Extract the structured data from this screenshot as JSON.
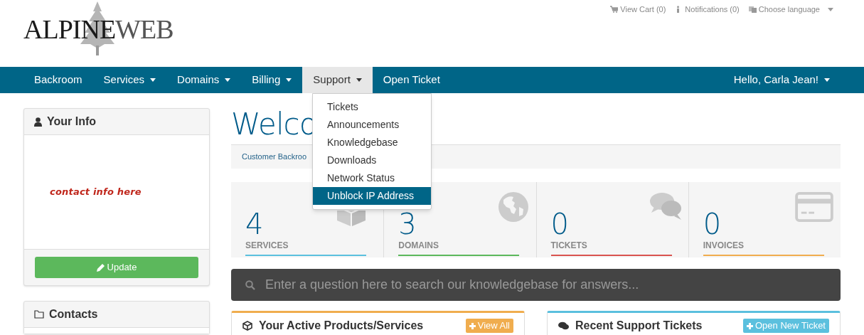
{
  "logo": {
    "part_1": "ALPINE",
    "part_2": "WEB"
  },
  "top_links": [
    {
      "kind": "cart",
      "label": "View Cart (0)",
      "caret": false
    },
    {
      "kind": "info",
      "label": "Notifications (0)",
      "caret": false
    },
    {
      "kind": "language",
      "label": "Choose language",
      "caret": true
    }
  ],
  "nav": {
    "items": [
      {
        "label": "Backroom",
        "caret": false,
        "selected": false
      },
      {
        "label": "Services",
        "caret": true,
        "selected": false
      },
      {
        "label": "Domains",
        "caret": true,
        "selected": false
      },
      {
        "label": "Billing",
        "caret": true,
        "selected": false
      },
      {
        "label": "Support",
        "caret": true,
        "selected": true
      },
      {
        "label": "Open Ticket",
        "caret": false,
        "selected": false
      }
    ],
    "user": {
      "label": "Hello, Carla Jean!",
      "caret": true
    }
  },
  "dropdown": [
    {
      "label": "Tickets",
      "selected": false
    },
    {
      "label": "Announcements",
      "selected": false
    },
    {
      "label": "Knowledgebase",
      "selected": false
    },
    {
      "label": "Downloads",
      "selected": false
    },
    {
      "label": "Network Status",
      "selected": false
    },
    {
      "label": "Unblock IP Address",
      "selected": true
    }
  ],
  "sidebar": [
    {
      "kind": "info",
      "title": "Your Info",
      "body": "contact info here",
      "button": "Update"
    },
    {
      "kind": "contacts",
      "title": "Contacts"
    }
  ],
  "heading": "Welco",
  "breadcrumb": "Customer Backroo",
  "stats": [
    {
      "kind": "services",
      "value": "4",
      "label": "SERVICES",
      "color": "#5bc0de"
    },
    {
      "kind": "domains",
      "value": "3",
      "label": "DOMAINS",
      "color": "#5cb85c"
    },
    {
      "kind": "tickets",
      "value": "0",
      "label": "TICKETS",
      "color": "#d9534f"
    },
    {
      "kind": "invoices",
      "value": "0",
      "label": "INVOICES",
      "color": "#f0ad4e"
    }
  ],
  "search": {
    "placeholder": "Enter a question here to search our knowledgebase for answers..."
  },
  "panels": [
    {
      "kind": "products",
      "title": "Your Active Products/Services",
      "button": "View All",
      "color": "#f0ad4e"
    },
    {
      "kind": "tickets",
      "title": "Recent Support Tickets",
      "button": "Open New Ticket",
      "color": "#5bc0de"
    }
  ]
}
